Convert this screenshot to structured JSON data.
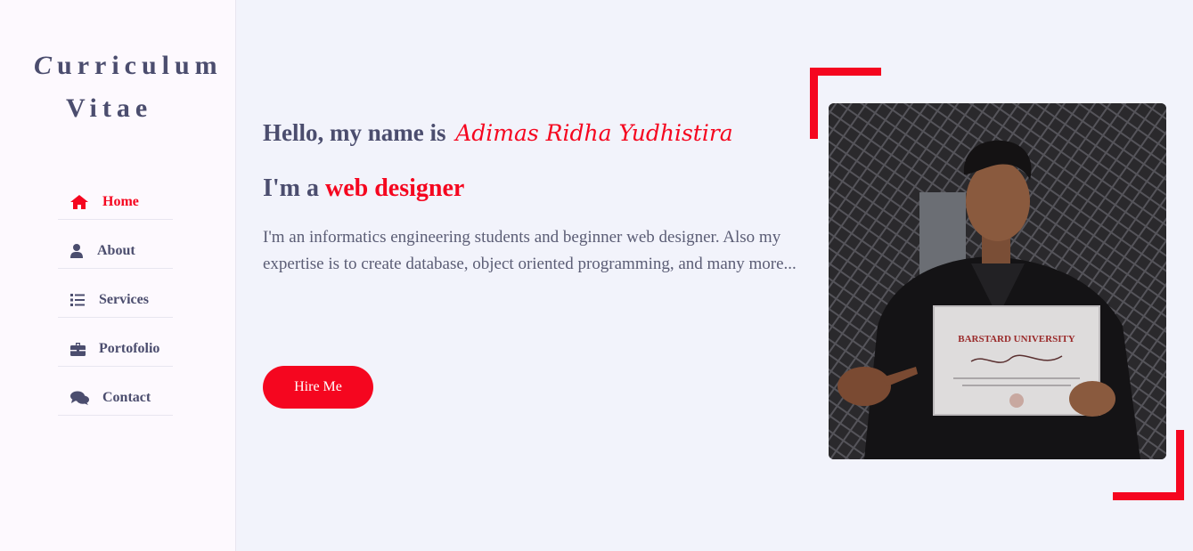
{
  "sidebar": {
    "logo_line1_first": "C",
    "logo_line1_rest": "urriculum",
    "logo_line2": "Vitae",
    "items": [
      {
        "label": "Home",
        "icon": "home-icon",
        "active": true
      },
      {
        "label": "About",
        "icon": "user-icon",
        "active": false
      },
      {
        "label": "Services",
        "icon": "list-icon",
        "active": false
      },
      {
        "label": "Portofolio",
        "icon": "briefcase-icon",
        "active": false
      },
      {
        "label": "Contact",
        "icon": "comments-icon",
        "active": false
      }
    ]
  },
  "hero": {
    "greeting": "Hello, my name is",
    "name": "Adimas Ridha Yudhistira",
    "role_prefix": "I'm a",
    "role": "web designer",
    "description": "I'm an informatics engineering students and beginner web designer. Also my expertise is to create database, object oriented programming, and many more...",
    "button_label": "Hire Me",
    "certificate_title": "BARSTARD UNIVERSITY"
  },
  "colors": {
    "accent": "#f5061f",
    "text": "#4b4d6e",
    "background": "#f2f3fb",
    "sidebar": "#fdf9fe"
  }
}
